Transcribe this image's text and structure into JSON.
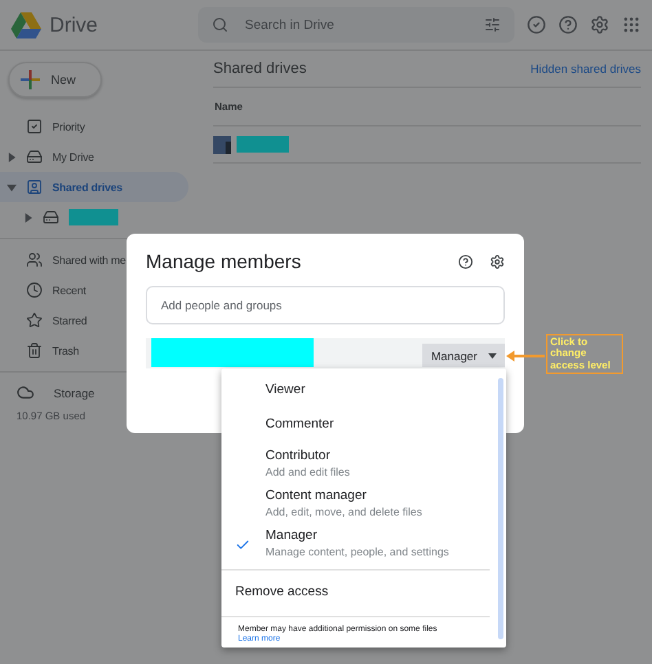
{
  "header": {
    "app_name": "Drive",
    "search": {
      "placeholder": "Search in Drive"
    }
  },
  "sidebar": {
    "new_button": "New",
    "groups": [
      {
        "items": [
          {
            "label": "Priority",
            "selected": false,
            "expandable": false
          },
          {
            "label": "My Drive",
            "selected": false,
            "expandable": true,
            "expanded": false
          },
          {
            "label": "Shared drives",
            "selected": true,
            "expandable": true,
            "expanded": true,
            "children": [
              {
                "kind": "redacted",
                "selected": false,
                "expandable": true,
                "expanded": false
              }
            ]
          }
        ]
      },
      {
        "items": [
          {
            "label": "Shared with me",
            "selected": false,
            "expandable": false
          },
          {
            "label": "Recent",
            "selected": false,
            "expandable": false
          },
          {
            "label": "Starred",
            "selected": false,
            "expandable": false
          },
          {
            "label": "Trash",
            "selected": false,
            "expandable": false
          }
        ]
      }
    ],
    "storage": {
      "label": "Storage",
      "used": "10.97 GB used"
    }
  },
  "main": {
    "title": "Shared drives",
    "link": "Hidden shared drives",
    "table": {
      "columns": [
        "Name"
      ],
      "rows": [
        {
          "kind": "redacted"
        }
      ]
    }
  },
  "dialog": {
    "title": "Manage members",
    "input": {
      "placeholder": "Add people and groups"
    },
    "member": {
      "kind": "redacted",
      "role": "Manager"
    },
    "menu": {
      "options": [
        {
          "label": "Viewer",
          "selected": false
        },
        {
          "label": "Commenter",
          "selected": false
        },
        {
          "label": "Contributor",
          "description": "Add and edit files",
          "selected": false
        },
        {
          "label": "Content manager",
          "description": "Add, edit, move, and delete files",
          "selected": false
        },
        {
          "label": "Manager",
          "description": "Manage content, people, and settings",
          "selected": true
        }
      ],
      "remove": "Remove access",
      "note": "Member may have additional permission on some files",
      "learn_more": "Learn more"
    }
  },
  "annotation": {
    "lines": [
      "Click to",
      "change",
      "access level"
    ]
  }
}
